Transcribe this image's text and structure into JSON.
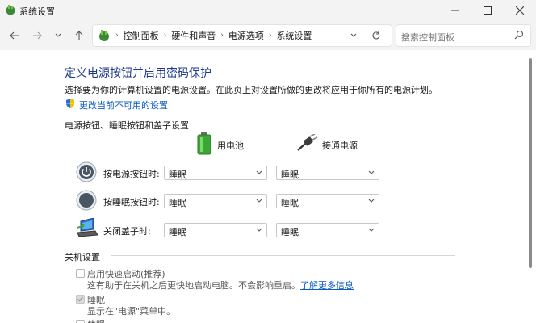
{
  "window": {
    "title": "系统设置"
  },
  "nav": {
    "breadcrumbs": [
      "控制面板",
      "硬件和声音",
      "电源选项",
      "系统设置"
    ],
    "search_placeholder": "搜索控制面板"
  },
  "page": {
    "title": "定义电源按钮并启用密码保护",
    "description": "选择要为你的计算机设置的电源设置。在此页上对设置所做的更改将应用于你所有的电源计划。",
    "change_link": "更改当前不可用的设置"
  },
  "power_section": {
    "heading": "电源按钮、睡眠按钮和盖子设置",
    "columns": [
      "用电池",
      "接通电源"
    ],
    "rows": [
      {
        "label": "按电源按钮时:",
        "battery": "睡眠",
        "plugged": "睡眠",
        "icon": "power-button-icon"
      },
      {
        "label": "按睡眠按钮时:",
        "battery": "睡眠",
        "plugged": "睡眠",
        "icon": "sleep-button-icon"
      },
      {
        "label": "关闭盖子时:",
        "battery": "睡眠",
        "plugged": "睡眠",
        "icon": "laptop-lid-icon"
      }
    ]
  },
  "shutdown_section": {
    "heading": "关机设置",
    "items": [
      {
        "label": "启用快速启动(推荐)",
        "desc": "这有助于在关机之后更快地启动电脑。不会影响重启。",
        "link": "了解更多信息",
        "checked": false
      },
      {
        "label": "睡眠",
        "desc": "显示在\"电源\"菜单中。",
        "checked": true
      },
      {
        "label": "休眠",
        "checked": false
      }
    ]
  },
  "colors": {
    "accent": "#0a5ac2",
    "title": "#1f3a8a",
    "chrome": "#f3f3f3"
  }
}
